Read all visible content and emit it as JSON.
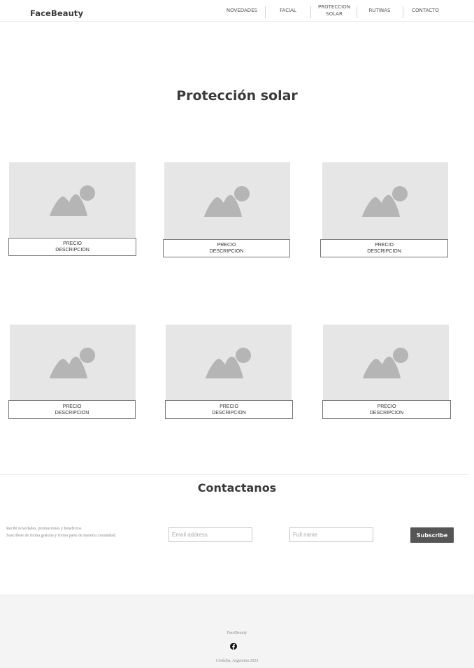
{
  "header": {
    "brand": "FaceBeauty",
    "nav": [
      "NOVEDADES",
      "FACIAL",
      "PROTECCION SOLAR",
      "RUTINAS",
      "CONTACTO"
    ],
    "nav_lines": {
      "novedades": "NOVEDADES",
      "facial": "FACIAL",
      "proteccion_1": "PROTECCION",
      "proteccion_2": "SOLAR",
      "rutinas": "RUTINAS",
      "contacto": "CONTACTO"
    }
  },
  "main": {
    "title": "Protección solar",
    "products": [
      {
        "price": "PRECIO",
        "description": "DESCRIPCION",
        "image_icon": "image-placeholder-icon"
      },
      {
        "price": "PRECIO",
        "description": "DESCRIPCION",
        "image_icon": "image-placeholder-icon"
      },
      {
        "price": "PRECIO",
        "description": "DESCRIPCION",
        "image_icon": "image-placeholder-icon"
      },
      {
        "price": "PRECIO",
        "description": "DESCRIPCION",
        "image_icon": "image-placeholder-icon"
      },
      {
        "price": "PRECIO",
        "description": "DESCRIPCION",
        "image_icon": "image-placeholder-icon"
      },
      {
        "price": "PRECIO",
        "description": "DESCRIPCION",
        "image_icon": "image-placeholder-icon"
      }
    ]
  },
  "contact": {
    "title": "Contactanos",
    "text_line1": "Recibí novedades, promociones y beneficios.",
    "text_line2": "Suscribete de forma gratuita y forma parte de nuestra comunidad.",
    "email_placeholder": "Email address",
    "name_placeholder": "Full name",
    "subscribe_label": "Subscribe"
  },
  "footer": {
    "brand": "FaceBeauty",
    "social_icon": "facebook-icon",
    "location": "Córdoba, Argentina 2023"
  },
  "colors": {
    "button_bg": "#555555",
    "image_placeholder_bg": "#e6e6e6",
    "footer_bg": "#f4f4f4"
  }
}
